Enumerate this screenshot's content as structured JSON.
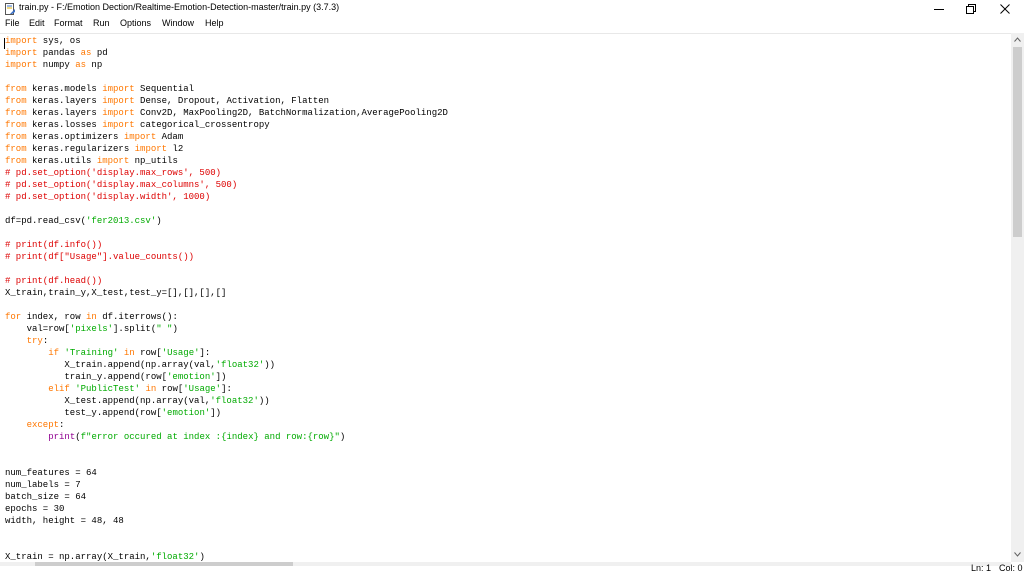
{
  "window": {
    "title": "train.py - F:/Emotion Dection/Realtime-Emotion-Detection-master/train.py (3.7.3)"
  },
  "menu": [
    "File",
    "Edit",
    "Format",
    "Run",
    "Options",
    "Window",
    "Help"
  ],
  "code_lines": [
    [
      [
        "kw",
        "import"
      ],
      [
        "p",
        " sys, os"
      ]
    ],
    [
      [
        "kw",
        "import"
      ],
      [
        "p",
        " pandas "
      ],
      [
        "kw",
        "as"
      ],
      [
        "p",
        " pd"
      ]
    ],
    [
      [
        "kw",
        "import"
      ],
      [
        "p",
        " numpy "
      ],
      [
        "kw",
        "as"
      ],
      [
        "p",
        " np"
      ]
    ],
    [],
    [
      [
        "kw",
        "from"
      ],
      [
        "p",
        " keras.models "
      ],
      [
        "kw",
        "import"
      ],
      [
        "p",
        " Sequential"
      ]
    ],
    [
      [
        "kw",
        "from"
      ],
      [
        "p",
        " keras.layers "
      ],
      [
        "kw",
        "import"
      ],
      [
        "p",
        " Dense, Dropout, Activation, Flatten"
      ]
    ],
    [
      [
        "kw",
        "from"
      ],
      [
        "p",
        " keras.layers "
      ],
      [
        "kw",
        "import"
      ],
      [
        "p",
        " Conv2D, MaxPooling2D, BatchNormalization,AveragePooling2D"
      ]
    ],
    [
      [
        "kw",
        "from"
      ],
      [
        "p",
        " keras.losses "
      ],
      [
        "kw",
        "import"
      ],
      [
        "p",
        " categorical_crossentropy"
      ]
    ],
    [
      [
        "kw",
        "from"
      ],
      [
        "p",
        " keras.optimizers "
      ],
      [
        "kw",
        "import"
      ],
      [
        "p",
        " Adam"
      ]
    ],
    [
      [
        "kw",
        "from"
      ],
      [
        "p",
        " keras.regularizers "
      ],
      [
        "kw",
        "import"
      ],
      [
        "p",
        " l2"
      ]
    ],
    [
      [
        "kw",
        "from"
      ],
      [
        "p",
        " keras.utils "
      ],
      [
        "kw",
        "import"
      ],
      [
        "p",
        " np_utils"
      ]
    ],
    [
      [
        "cmt",
        "# pd.set_option('display.max_rows', 500)"
      ]
    ],
    [
      [
        "cmt",
        "# pd.set_option('display.max_columns', 500)"
      ]
    ],
    [
      [
        "cmt",
        "# pd.set_option('display.width', 1000)"
      ]
    ],
    [],
    [
      [
        "p",
        "df=pd.read_csv("
      ],
      [
        "str",
        "'fer2013.csv'"
      ],
      [
        "p",
        ")"
      ]
    ],
    [],
    [
      [
        "cmt",
        "# print(df.info())"
      ]
    ],
    [
      [
        "cmt",
        "# print(df[\"Usage\"].value_counts())"
      ]
    ],
    [],
    [
      [
        "cmt",
        "# print(df.head())"
      ]
    ],
    [
      [
        "p",
        "X_train,train_y,X_test,test_y=[],[],[],[]"
      ]
    ],
    [],
    [
      [
        "kw",
        "for"
      ],
      [
        "p",
        " index, row "
      ],
      [
        "kw",
        "in"
      ],
      [
        "p",
        " df.iterrows():"
      ]
    ],
    [
      [
        "p",
        "    val=row["
      ],
      [
        "str",
        "'pixels'"
      ],
      [
        "p",
        "].split("
      ],
      [
        "str",
        "\" \""
      ],
      [
        "p",
        ")"
      ]
    ],
    [
      [
        "p",
        "    "
      ],
      [
        "kw",
        "try"
      ],
      [
        "p",
        ":"
      ]
    ],
    [
      [
        "p",
        "        "
      ],
      [
        "kw",
        "if"
      ],
      [
        "p",
        " "
      ],
      [
        "str",
        "'Training'"
      ],
      [
        "p",
        " "
      ],
      [
        "kw",
        "in"
      ],
      [
        "p",
        " row["
      ],
      [
        "str",
        "'Usage'"
      ],
      [
        "p",
        "]:"
      ]
    ],
    [
      [
        "p",
        "           X_train.append(np.array(val,"
      ],
      [
        "str",
        "'float32'"
      ],
      [
        "p",
        "))"
      ]
    ],
    [
      [
        "p",
        "           train_y.append(row["
      ],
      [
        "str",
        "'emotion'"
      ],
      [
        "p",
        "])"
      ]
    ],
    [
      [
        "p",
        "        "
      ],
      [
        "kw",
        "elif"
      ],
      [
        "p",
        " "
      ],
      [
        "str",
        "'PublicTest'"
      ],
      [
        "p",
        " "
      ],
      [
        "kw",
        "in"
      ],
      [
        "p",
        " row["
      ],
      [
        "str",
        "'Usage'"
      ],
      [
        "p",
        "]:"
      ]
    ],
    [
      [
        "p",
        "           X_test.append(np.array(val,"
      ],
      [
        "str",
        "'float32'"
      ],
      [
        "p",
        "))"
      ]
    ],
    [
      [
        "p",
        "           test_y.append(row["
      ],
      [
        "str",
        "'emotion'"
      ],
      [
        "p",
        "])"
      ]
    ],
    [
      [
        "p",
        "    "
      ],
      [
        "kw",
        "except"
      ],
      [
        "p",
        ":"
      ]
    ],
    [
      [
        "p",
        "        "
      ],
      [
        "bi",
        "print"
      ],
      [
        "p",
        "("
      ],
      [
        "str",
        "f\"error occured at index :{index} and row:{row}\""
      ],
      [
        "p",
        ")"
      ]
    ],
    [],
    [],
    [
      [
        "p",
        "num_features = 64"
      ]
    ],
    [
      [
        "p",
        "num_labels = 7"
      ]
    ],
    [
      [
        "p",
        "batch_size = 64"
      ]
    ],
    [
      [
        "p",
        "epochs = 30"
      ]
    ],
    [
      [
        "p",
        "width, height = 48, 48"
      ]
    ],
    [],
    [],
    [
      [
        "p",
        "X_train = np.array(X_train,"
      ],
      [
        "str",
        "'float32'"
      ],
      [
        "p",
        ")"
      ]
    ]
  ],
  "status": {
    "line": "Ln: 1",
    "col": "Col: 0"
  },
  "icons": {
    "app": "idle-file-icon",
    "minimize": "minimize-icon",
    "maximize": "restore-icon",
    "close": "close-icon"
  }
}
